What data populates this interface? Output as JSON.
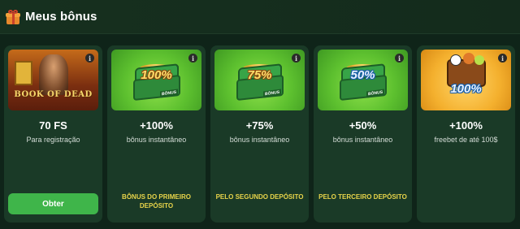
{
  "header": {
    "title": "Meus bônus",
    "icon": "gift-icon"
  },
  "cards": [
    {
      "image": "book-of-dead-game-art",
      "logo_text": "BOOK OF DEAD",
      "value": "70 FS",
      "description": "Para registração",
      "button_label": "Obter",
      "note": ""
    },
    {
      "image": "green-chest-100",
      "image_text": "100%",
      "tag": "BÔNUS",
      "value": "+100%",
      "description": "bônus instantâneo",
      "note": "BÔNUS DO PRIMEIRO DEPÓSITO"
    },
    {
      "image": "green-chest-75",
      "image_text": "75%",
      "tag": "BÔNUS",
      "value": "+75%",
      "description": "bônus instantâneo",
      "note": "PELO SEGUNDO DEPÓSITO"
    },
    {
      "image": "green-chest-50",
      "image_text": "50%",
      "tag": "BÔNUS",
      "value": "+50%",
      "description": "bônus instantâneo",
      "note": "PELO TERCEIRO DEPÓSITO"
    },
    {
      "image": "sports-chest-100",
      "image_text": "100%",
      "value": "+100%",
      "description": "freebet de até 100$",
      "note": ""
    }
  ],
  "info_icon": "i",
  "colors": {
    "background": "#0f2419",
    "card": "#1a3a27",
    "button": "#3fb54a",
    "note": "#e8d44a"
  }
}
